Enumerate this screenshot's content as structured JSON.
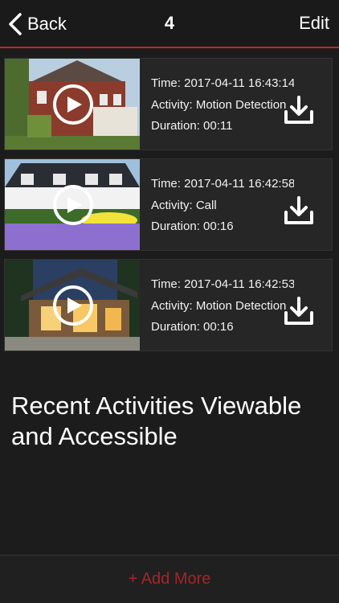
{
  "header": {
    "back_label": "Back",
    "title": "4",
    "edit_label": "Edit"
  },
  "activities": [
    {
      "time": "Time: 2017-04-11 16:43:14",
      "activity": "Activity: Motion Detection",
      "duration": "Duration: 00:11"
    },
    {
      "time": "Time: 2017-04-11 16:42:58",
      "activity": "Activity: Call",
      "duration": "Duration: 00:16"
    },
    {
      "time": "Time: 2017-04-11 16:42:53",
      "activity": "Activity: Motion Detection",
      "duration": "Duration: 00:16"
    }
  ],
  "headline": "Recent Activities Viewable and Accessible",
  "footer": {
    "add_more_label": "+ Add More"
  },
  "colors": {
    "accent": "#c0272d",
    "background": "#1c1c1c",
    "card": "#262626"
  },
  "icons": {
    "back": "chevron-left-icon",
    "play": "play-icon",
    "download": "download-icon"
  }
}
